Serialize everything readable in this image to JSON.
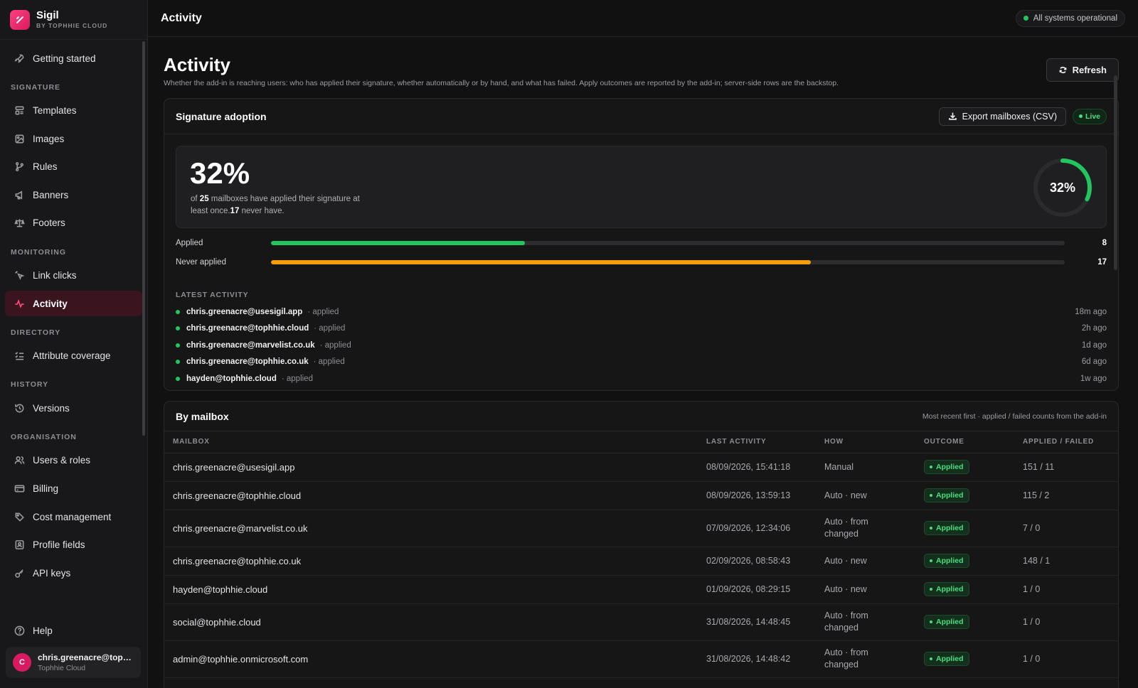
{
  "brand": {
    "name": "Sigil",
    "sub": "BY TOPHHIE CLOUD"
  },
  "sidebar": {
    "top_items": [
      {
        "label": "Getting started",
        "icon": "rocket-icon"
      }
    ],
    "sections": [
      {
        "title": "SIGNATURE",
        "items": [
          {
            "label": "Templates",
            "icon": "templates-icon"
          },
          {
            "label": "Images",
            "icon": "image-icon"
          },
          {
            "label": "Rules",
            "icon": "branch-icon"
          },
          {
            "label": "Banners",
            "icon": "megaphone-icon"
          },
          {
            "label": "Footers",
            "icon": "scale-icon"
          }
        ]
      },
      {
        "title": "MONITORING",
        "items": [
          {
            "label": "Link clicks",
            "icon": "cursor-click-icon"
          },
          {
            "label": "Activity",
            "icon": "activity-icon",
            "active": true
          }
        ]
      },
      {
        "title": "DIRECTORY",
        "items": [
          {
            "label": "Attribute coverage",
            "icon": "list-check-icon"
          }
        ]
      },
      {
        "title": "HISTORY",
        "items": [
          {
            "label": "Versions",
            "icon": "history-icon"
          }
        ]
      },
      {
        "title": "ORGANISATION",
        "items": [
          {
            "label": "Users & roles",
            "icon": "users-icon"
          },
          {
            "label": "Billing",
            "icon": "credit-card-icon"
          },
          {
            "label": "Cost management",
            "icon": "tag-icon"
          },
          {
            "label": "Profile fields",
            "icon": "profile-card-icon"
          },
          {
            "label": "API keys",
            "icon": "key-icon"
          }
        ]
      }
    ],
    "help": "Help",
    "user": {
      "initial": "C",
      "email": "chris.greenacre@tophhie.cloud",
      "org": "Tophhie Cloud"
    }
  },
  "topbar": {
    "title": "Activity",
    "status": "All systems operational"
  },
  "page": {
    "title": "Activity",
    "description": "Whether the add-in is reaching users: who has applied their signature, whether automatically or by hand, and what has failed. Apply outcomes are reported by the add-in; server-side rows are the backstop.",
    "refresh": "Refresh"
  },
  "adoption": {
    "title": "Signature adoption",
    "export": "Export mailboxes (CSV)",
    "live": "Live",
    "percent": "32%",
    "percent_value": 0.32,
    "text_of": "of",
    "total": "25",
    "text_mid": "mailboxes have applied their signature at least once.",
    "never": "17",
    "text_end": "never have.",
    "bars": [
      {
        "label": "Applied",
        "count": "8",
        "fraction": 0.32,
        "color": "#22c55e"
      },
      {
        "label": "Never applied",
        "count": "17",
        "fraction": 0.68,
        "color": "#f59e0b"
      }
    ],
    "latest_title": "LATEST ACTIVITY",
    "latest": [
      {
        "mail": "chris.greenacre@usesigil.app",
        "verb": "· applied",
        "time": "18m ago"
      },
      {
        "mail": "chris.greenacre@tophhie.cloud",
        "verb": "· applied",
        "time": "2h ago"
      },
      {
        "mail": "chris.greenacre@marvelist.co.uk",
        "verb": "· applied",
        "time": "1d ago"
      },
      {
        "mail": "chris.greenacre@tophhie.co.uk",
        "verb": "· applied",
        "time": "6d ago"
      },
      {
        "mail": "hayden@tophhie.cloud",
        "verb": "· applied",
        "time": "1w ago"
      }
    ]
  },
  "mailbox": {
    "title": "By mailbox",
    "note": "Most recent first · applied / failed counts from the add-in",
    "columns": [
      "MAILBOX",
      "LAST ACTIVITY",
      "HOW",
      "OUTCOME",
      "APPLIED / FAILED"
    ],
    "rows": [
      {
        "mail": "chris.greenacre@usesigil.app",
        "last": "08/09/2026, 15:41:18",
        "how": "Manual",
        "outcome": "Applied",
        "counts": "151 / 11"
      },
      {
        "mail": "chris.greenacre@tophhie.cloud",
        "last": "08/09/2026, 13:59:13",
        "how": "Auto · new",
        "outcome": "Applied",
        "counts": "115 / 2"
      },
      {
        "mail": "chris.greenacre@marvelist.co.uk",
        "last": "07/09/2026, 12:34:06",
        "how": "Auto · from changed",
        "outcome": "Applied",
        "counts": "7 / 0"
      },
      {
        "mail": "chris.greenacre@tophhie.co.uk",
        "last": "02/09/2026, 08:58:43",
        "how": "Auto · new",
        "outcome": "Applied",
        "counts": "148 / 1"
      },
      {
        "mail": "hayden@tophhie.cloud",
        "last": "01/09/2026, 08:29:15",
        "how": "Auto · new",
        "outcome": "Applied",
        "counts": "1 / 0"
      },
      {
        "mail": "social@tophhie.cloud",
        "last": "31/08/2026, 14:48:45",
        "how": "Auto · from changed",
        "outcome": "Applied",
        "counts": "1 / 0"
      },
      {
        "mail": "admin@tophhie.onmicrosoft.com",
        "last": "31/08/2026, 14:48:42",
        "how": "Auto · from changed",
        "outcome": "Applied",
        "counts": "1 / 0"
      }
    ]
  },
  "colors": {
    "accent": "#ff4d7d",
    "success": "#22c55e",
    "warning": "#f59e0b"
  }
}
